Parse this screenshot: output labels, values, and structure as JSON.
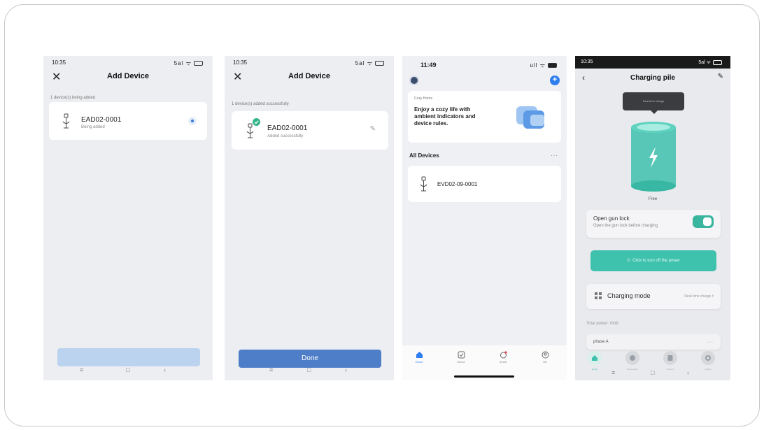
{
  "screen1": {
    "status_time": "10:35",
    "status_signal": "5al",
    "title": "Add Device",
    "close_icon": "close-icon",
    "note": "1 device(s) being added",
    "device": {
      "name": "EAD02-0001",
      "status": "Being added"
    },
    "nav_keys": [
      "≡",
      "□",
      "‹"
    ]
  },
  "screen2": {
    "status_time": "10:35",
    "status_signal": "5al",
    "title": "Add Device",
    "note": "1 device(s) added successfully",
    "device": {
      "name": "EAD02-0001",
      "status": "Added successfully"
    },
    "done_label": "Done",
    "nav_keys": [
      "≡",
      "□",
      "‹"
    ]
  },
  "screen3": {
    "status_time": "11:49",
    "status_signal": "ull",
    "promo_label": "Cozy Home",
    "promo_text": "Enjoy a cozy life with ambient indicators and device rules.",
    "all_devices": "All Devices",
    "more_dots": "···",
    "device_name": "EVD02-09-0001",
    "tabs": [
      {
        "label": "Home",
        "icon": "home-icon"
      },
      {
        "label": "Scene",
        "icon": "scene-icon"
      },
      {
        "label": "Smart",
        "icon": "smart-icon"
      },
      {
        "label": "Me",
        "icon": "profile-icon"
      }
    ],
    "accent": "#2f7ef0"
  },
  "screen4": {
    "status_time": "10:35",
    "status_signal": "5al",
    "title": "Charging pile",
    "tooltip": "Real-time charge",
    "state": "Free",
    "gun_lock_title": "Open gun lock",
    "gun_lock_sub": "Open the gun lock before charging",
    "power_button": "Click to turn off the power",
    "mode_title": "Charging mode",
    "mode_value": "Real-time charge",
    "total_power": "Total power: 0kW",
    "phase": "phase A",
    "more_dots": "···",
    "tabs": [
      {
        "label": "Home",
        "icon": "home-icon"
      },
      {
        "label": "Reservation",
        "icon": "clock-icon"
      },
      {
        "label": "Record",
        "icon": "record-icon"
      },
      {
        "label": "Setting",
        "icon": "gear-icon"
      }
    ],
    "nav_keys": [
      "≡",
      "□",
      "‹"
    ],
    "accent": "#3ec1ad"
  }
}
